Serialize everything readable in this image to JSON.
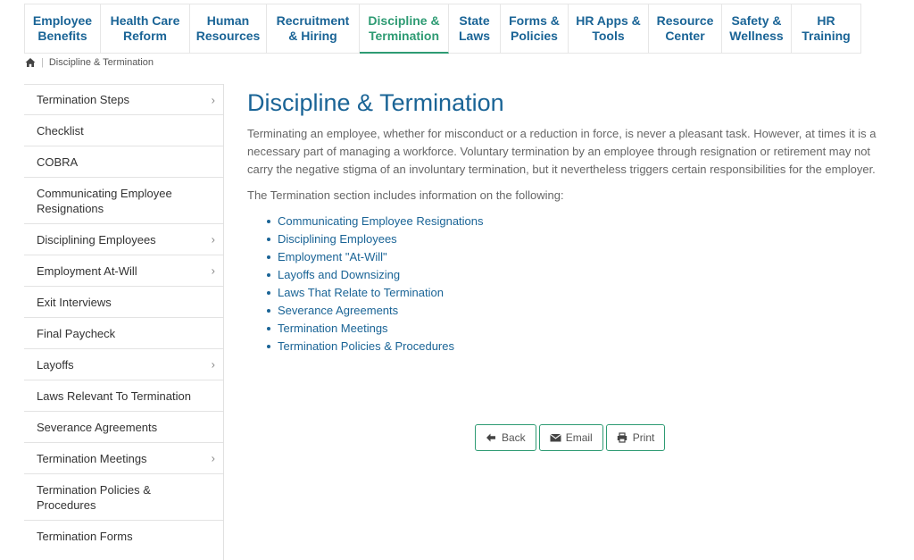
{
  "topnav": [
    {
      "label": "Employee\nBenefits",
      "active": false
    },
    {
      "label": "Health Care\nReform",
      "active": false
    },
    {
      "label": "Human\nResources",
      "active": false
    },
    {
      "label": "Recruitment\n& Hiring",
      "active": false
    },
    {
      "label": "Discipline &\nTermination",
      "active": true
    },
    {
      "label": "State\nLaws",
      "active": false
    },
    {
      "label": "Forms &\nPolicies",
      "active": false
    },
    {
      "label": "HR Apps &\nTools",
      "active": false
    },
    {
      "label": "Resource\nCenter",
      "active": false
    },
    {
      "label": "Safety &\nWellness",
      "active": false
    },
    {
      "label": "HR\nTraining",
      "active": false
    }
  ],
  "breadcrumb": {
    "current": "Discipline & Termination"
  },
  "sidebar": {
    "items": [
      {
        "label": "Termination Steps",
        "has_children": true
      },
      {
        "label": "Checklist",
        "has_children": false
      },
      {
        "label": "COBRA",
        "has_children": false
      },
      {
        "label": "Communicating Employee Resignations",
        "has_children": false
      },
      {
        "label": "Disciplining Employees",
        "has_children": true
      },
      {
        "label": "Employment At-Will",
        "has_children": true
      },
      {
        "label": "Exit Interviews",
        "has_children": false
      },
      {
        "label": "Final Paycheck",
        "has_children": false
      },
      {
        "label": "Layoffs",
        "has_children": true
      },
      {
        "label": "Laws Relevant To Termination",
        "has_children": false
      },
      {
        "label": "Severance Agreements",
        "has_children": false
      },
      {
        "label": "Termination Meetings",
        "has_children": true
      },
      {
        "label": "Termination Policies & Procedures",
        "has_children": false
      },
      {
        "label": "Termination Forms",
        "has_children": false
      }
    ]
  },
  "main": {
    "title": "Discipline & Termination",
    "intro": "Terminating an employee, whether for misconduct or a reduction in force, is never a pleasant task. However, at times it is a necessary part of managing a workforce. Voluntary termination by an employee through resignation or retirement may not carry the negative stigma of an involuntary termination, but it nevertheless triggers certain responsibilities for the employer.",
    "list_intro": "The Termination section includes information on the following:",
    "links": [
      "Communicating Employee Resignations",
      "Disciplining Employees",
      "Employment \"At-Will\"",
      "Layoffs and Downsizing",
      "Laws That Relate to Termination",
      "Severance Agreements",
      "Termination Meetings",
      "Termination Policies & Procedures"
    ]
  },
  "actions": {
    "back": "Back",
    "email": "Email",
    "print": "Print"
  },
  "colors": {
    "link": "#1a6496",
    "accent": "#2e9b73"
  }
}
